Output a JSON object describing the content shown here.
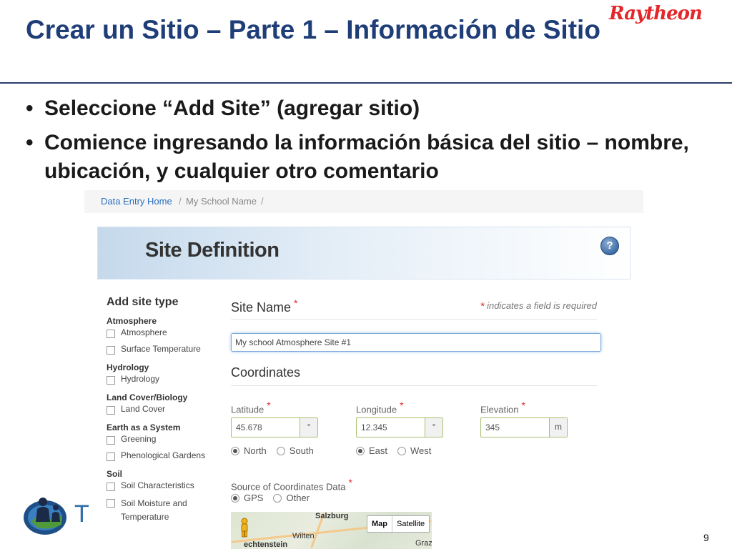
{
  "slide": {
    "title": "Crear un Sitio – Parte 1 – Información de Sitio",
    "brand": "Raytheon",
    "bullets": [
      "Seleccione “Add Site” (agregar sitio)",
      "Comience ingresando la información básica del sitio – nombre, ubicación, y cualquier otro comentario"
    ],
    "bullet_glyph": "•",
    "page_number": "9",
    "partial_letter": "T"
  },
  "screenshot": {
    "breadcrumb": {
      "home": "Data Entry Home",
      "separator": "/",
      "current": "My School Name"
    },
    "header_title": "Site Definition",
    "help_glyph": "?",
    "site_types": {
      "heading": "Add site type",
      "groups": [
        {
          "label": "Atmosphere",
          "items": [
            "Atmosphere",
            "Surface Temperature"
          ]
        },
        {
          "label": "Hydrology",
          "items": [
            "Hydrology"
          ]
        },
        {
          "label": "Land Cover/Biology",
          "items": [
            "Land Cover"
          ]
        },
        {
          "label": "Earth as a System",
          "items": [
            "Greening",
            "Phenological Gardens"
          ]
        },
        {
          "label": "Soil",
          "items": [
            "Soil Characteristics",
            "Soil Moisture and Temperature"
          ]
        }
      ]
    },
    "form": {
      "site_name_label": "Site Name",
      "required_star": "*",
      "required_note": "indicates a field is required",
      "site_name_value": "My school Atmosphere Site #1",
      "coordinates_label": "Coordinates",
      "latitude_label": "Latitude",
      "latitude_value": "45.678",
      "latitude_unit": "°",
      "longitude_label": "Longitude",
      "longitude_value": "12.345",
      "longitude_unit": "°",
      "elevation_label": "Elevation",
      "elevation_value": "345",
      "elevation_unit": "m",
      "lat_options": [
        "North",
        "South"
      ],
      "lat_selected": "North",
      "lon_options": [
        "East",
        "West"
      ],
      "lon_selected": "East",
      "source_label": "Source of Coordinates Data",
      "source_options": [
        "GPS",
        "Other"
      ],
      "source_selected": "GPS"
    },
    "map": {
      "labels": [
        "Salzburg",
        "Wilten",
        "echtenstein",
        "Graz"
      ],
      "toggle_map": "Map",
      "toggle_satellite": "Satellite"
    }
  }
}
